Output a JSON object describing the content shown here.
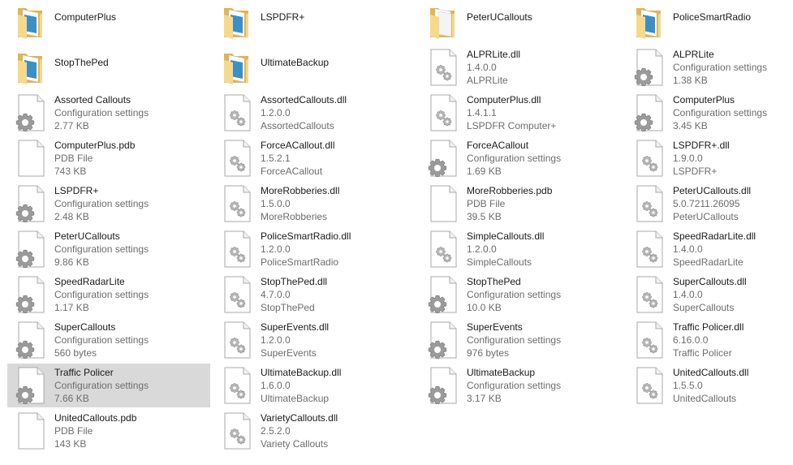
{
  "view": "tiles",
  "columns": 4,
  "items": [
    {
      "name": "ComputerPlus",
      "type": "folder"
    },
    {
      "name": "LSPDFR+",
      "type": "folder"
    },
    {
      "name": "PeterUCallouts",
      "type": "folder-plain"
    },
    {
      "name": "PoliceSmartRadio",
      "type": "folder"
    },
    {
      "name": "StopThePed",
      "type": "folder"
    },
    {
      "name": "UltimateBackup",
      "type": "folder"
    },
    {
      "name": "ALPRLite.dll",
      "type": "dll",
      "line2": "1.4.0.0",
      "line3": "ALPRLite"
    },
    {
      "name": "ALPRLite",
      "type": "config",
      "line2": "Configuration settings",
      "line3": "1.38 KB"
    },
    {
      "name": "Assorted Callouts",
      "type": "config",
      "line2": "Configuration settings",
      "line3": "2.77 KB"
    },
    {
      "name": "AssortedCallouts.dll",
      "type": "dll",
      "line2": "1.2.0.0",
      "line3": "AssortedCallouts"
    },
    {
      "name": "ComputerPlus.dll",
      "type": "dll",
      "line2": "1.4.1.1",
      "line3": "LSPDFR Computer+"
    },
    {
      "name": "ComputerPlus",
      "type": "config",
      "line2": "Configuration settings",
      "line3": "3.45 KB"
    },
    {
      "name": "ComputerPlus.pdb",
      "type": "pdb",
      "line2": "PDB File",
      "line3": "743 KB"
    },
    {
      "name": "ForceACallout.dll",
      "type": "dll",
      "line2": "1.5.2.1",
      "line3": "ForceACallout"
    },
    {
      "name": "ForceACallout",
      "type": "config",
      "line2": "Configuration settings",
      "line3": "1.69 KB"
    },
    {
      "name": "LSPDFR+.dll",
      "type": "dll",
      "line2": "1.9.0.0",
      "line3": "LSPDFR+"
    },
    {
      "name": "LSPDFR+",
      "type": "config",
      "line2": "Configuration settings",
      "line3": "2.48 KB"
    },
    {
      "name": "MoreRobberies.dll",
      "type": "dll",
      "line2": "1.5.0.0",
      "line3": "MoreRobberies"
    },
    {
      "name": "MoreRobberies.pdb",
      "type": "pdb",
      "line2": "PDB File",
      "line3": "39.5 KB"
    },
    {
      "name": "PeterUCallouts.dll",
      "type": "dll",
      "line2": "5.0.7211.26095",
      "line3": "PeterUCallouts"
    },
    {
      "name": "PeterUCallouts",
      "type": "config",
      "line2": "Configuration settings",
      "line3": "9.86 KB"
    },
    {
      "name": "PoliceSmartRadio.dll",
      "type": "dll",
      "line2": "1.2.0.0",
      "line3": "PoliceSmartRadio"
    },
    {
      "name": "SimpleCallouts.dll",
      "type": "dll",
      "line2": "1.2.0.0",
      "line3": "SimpleCallouts"
    },
    {
      "name": "SpeedRadarLite.dll",
      "type": "dll",
      "line2": "1.4.0.0",
      "line3": "SpeedRadarLite"
    },
    {
      "name": "SpeedRadarLite",
      "type": "config",
      "line2": "Configuration settings",
      "line3": "1.17 KB"
    },
    {
      "name": "StopThePed.dll",
      "type": "dll",
      "line2": "4.7.0.0",
      "line3": "StopThePed"
    },
    {
      "name": "StopThePed",
      "type": "config",
      "line2": "Configuration settings",
      "line3": "10.0 KB"
    },
    {
      "name": "SuperCallouts.dll",
      "type": "dll",
      "line2": "1.4.0.0",
      "line3": "SuperCallouts"
    },
    {
      "name": "SuperCallouts",
      "type": "config",
      "line2": "Configuration settings",
      "line3": "560 bytes"
    },
    {
      "name": "SuperEvents.dll",
      "type": "dll",
      "line2": "1.2.0.0",
      "line3": "SuperEvents"
    },
    {
      "name": "SuperEvents",
      "type": "config",
      "line2": "Configuration settings",
      "line3": "976 bytes"
    },
    {
      "name": "Traffic Policer.dll",
      "type": "dll",
      "line2": "6.16.0.0",
      "line3": "Traffic Policer"
    },
    {
      "name": "Traffic Policer",
      "type": "config",
      "line2": "Configuration settings",
      "line3": "7.66 KB",
      "selected": true
    },
    {
      "name": "UltimateBackup.dll",
      "type": "dll",
      "line2": "1.6.0.0",
      "line3": "UltimateBackup"
    },
    {
      "name": "UltimateBackup",
      "type": "config",
      "line2": "Configuration settings",
      "line3": "3.17 KB"
    },
    {
      "name": "UnitedCallouts.dll",
      "type": "dll",
      "line2": "1.5.5.0",
      "line3": "UnitedCallouts"
    },
    {
      "name": "UnitedCallouts.pdb",
      "type": "pdb",
      "line2": "PDB File",
      "line3": "143 KB"
    },
    {
      "name": "VarietyCallouts.dll",
      "type": "dll",
      "line2": "2.5.2.0",
      "line3": "Variety Callouts"
    }
  ]
}
